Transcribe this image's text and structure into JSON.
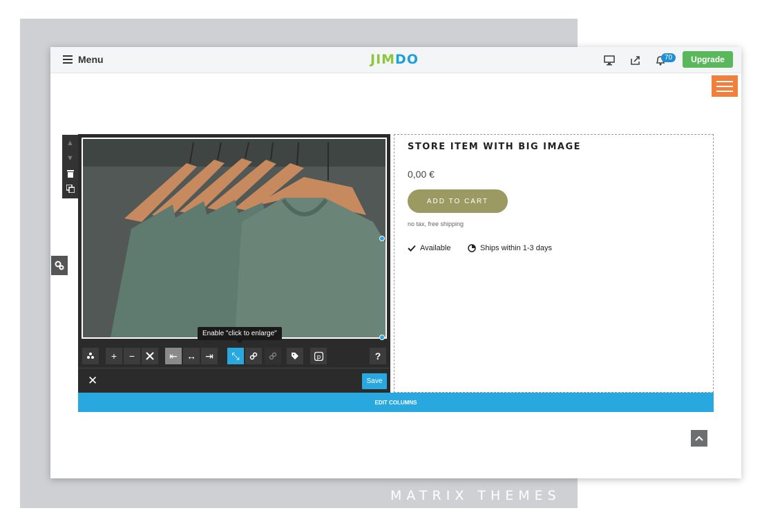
{
  "topbar": {
    "menu_label": "Menu",
    "logo_text_1": "JIM",
    "logo_text_2": "DO",
    "notification_count": "70",
    "upgrade_label": "Upgrade"
  },
  "image_editor": {
    "tooltip": "Enable \"click to enlarge\"",
    "save_label": "Save",
    "help_label": "?"
  },
  "product": {
    "title": "STORE ITEM WITH BIG IMAGE",
    "price": "0,00 €",
    "add_to_cart": "ADD TO CART",
    "tax_note": "no tax, free shipping",
    "availability": "Available",
    "shipping": "Ships within 1-3 days"
  },
  "edit_columns_label": "EDIT COLUMNS",
  "watermark": "MATRIX THEMES",
  "colors": {
    "accent_blue": "#29a8e0",
    "upgrade_green": "#5bb75b",
    "hamburger_orange": "#f0803c",
    "cart_olive": "#9b9a62"
  }
}
